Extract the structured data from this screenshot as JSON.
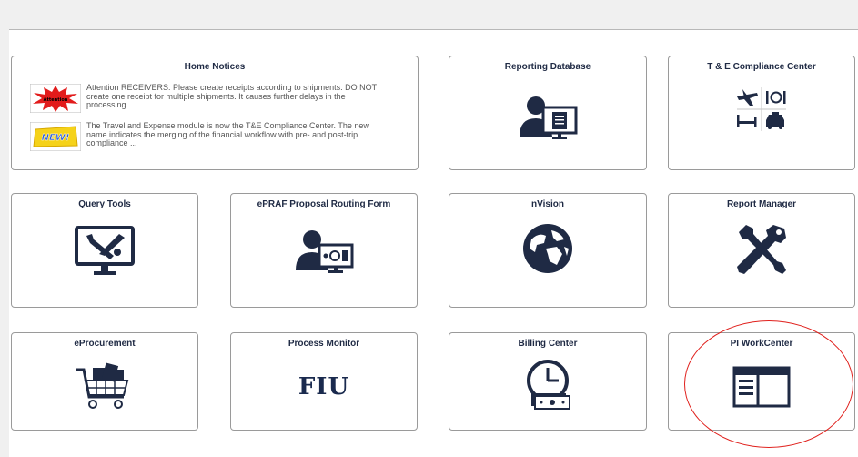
{
  "tiles": {
    "home_notices": {
      "title": "Home Notices",
      "notices": [
        {
          "badge": "Attention",
          "text": "Attention RECEIVERS: Please create receipts according to shipments. DO NOT create one receipt for multiple shipments. It causes further delays in the processing..."
        },
        {
          "badge": "NEW!",
          "text": "The Travel and Expense module is now the T&E Compliance Center. The new name indicates the merging of the financial workflow with pre- and post-trip compliance ..."
        }
      ]
    },
    "reporting_database": {
      "title": "Reporting Database"
    },
    "te_compliance": {
      "title": "T & E Compliance Center"
    },
    "query_tools": {
      "title": "Query Tools"
    },
    "epraf": {
      "title": "ePRAF Proposal Routing Form"
    },
    "nvision": {
      "title": "nVision"
    },
    "report_manager": {
      "title": "Report Manager"
    },
    "eprocurement": {
      "title": "eProcurement"
    },
    "process_monitor": {
      "title": "Process Monitor",
      "logo_text": "FIU"
    },
    "billing_center": {
      "title": "Billing Center"
    },
    "pi_workcenter": {
      "title": "PI WorkCenter"
    }
  },
  "colors": {
    "icon": "#1f2a44",
    "annotation_circle": "#e0201c"
  }
}
